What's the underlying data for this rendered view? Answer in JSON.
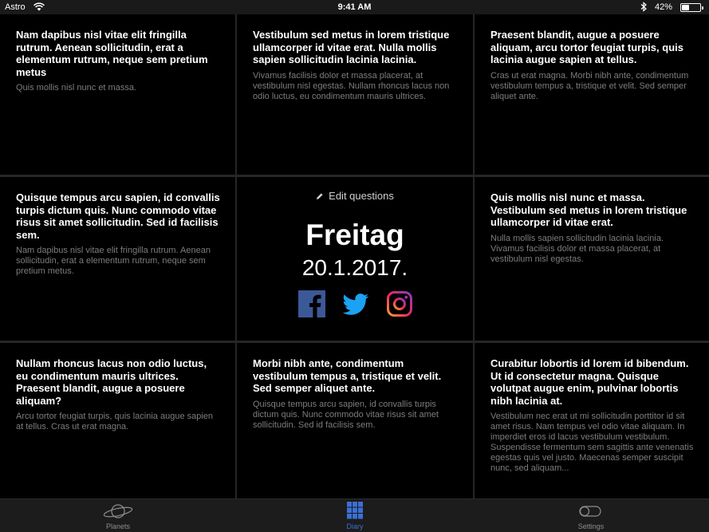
{
  "status_bar": {
    "carrier": "Astro",
    "time": "9:41 AM",
    "battery": "42%",
    "battery_level": 0.42,
    "icons": [
      "wifi-icon",
      "bluetooth-icon",
      "battery-icon"
    ]
  },
  "cards": [
    {
      "question": "Nam dapibus nisl vitae elit fringilla rutrum. Aenean sollicitudin, erat a elementum rutrum, neque sem pretium metus",
      "answer": "Quis mollis nisl nunc et massa."
    },
    {
      "question": "Vestibulum sed metus in lorem tristique ullamcorper id vitae erat. Nulla mollis sapien sollicitudin lacinia lacinia.",
      "answer": "Vivamus facilisis dolor et massa placerat, at vestibulum nisl egestas. Nullam rhoncus lacus non odio luctus, eu condimentum mauris ultrices."
    },
    {
      "question": "Praesent blandit, augue a posuere aliquam, arcu tortor feugiat turpis, quis lacinia augue sapien at tellus.",
      "answer": "Cras ut erat magna. Morbi nibh ante, condimentum vestibulum tempus a, tristique et velit. Sed semper aliquet ante."
    },
    {
      "question": "Quisque tempus arcu sapien, id convallis turpis dictum quis. Nunc commodo vitae risus sit amet sollicitudin. Sed id facilisis sem.",
      "answer": "Nam dapibus nisl vitae elit fringilla rutrum. Aenean sollicitudin, erat a elementum rutrum, neque sem pretium metus."
    },
    {
      "question": "Quis mollis nisl nunc et massa. Vestibulum sed metus in lorem tristique ullamcorper id vitae erat.",
      "answer": "Nulla mollis sapien sollicitudin lacinia lacinia. Vivamus facilisis dolor et massa placerat, at vestibulum nisl egestas."
    },
    {
      "question": "Nullam rhoncus lacus non odio luctus, eu condimentum mauris ultrices. Praesent blandit, augue a posuere aliquam?",
      "answer": "Arcu tortor feugiat turpis, quis lacinia augue sapien at tellus. Cras ut erat magna."
    },
    {
      "question": "Morbi nibh ante, condimentum vestibulum tempus a, tristique et velit. Sed semper aliquet ante.",
      "answer": "Quisque tempus arcu sapien, id convallis turpis dictum quis. Nunc commodo vitae risus sit amet sollicitudin. Sed id facilisis sem."
    },
    {
      "question": "Curabitur lobortis id lorem id bibendum. Ut id consectetur magna. Quisque volutpat augue enim, pulvinar lobortis nibh lacinia at.",
      "answer": "Vestibulum nec erat ut mi sollicitudin porttitor id sit amet risus. Nam tempus vel odio vitae aliquam. In imperdiet eros id lacus vestibulum vestibulum. Suspendisse fermentum sem sagittis ante venenatis egestas quis vel justo. Maecenas semper suscipit nunc, sed aliquam..."
    }
  ],
  "center": {
    "edit_label": "Edit questions",
    "day": "Freitag",
    "date": "20.1.2017.",
    "social": [
      "facebook-icon",
      "twitter-icon",
      "instagram-icon"
    ]
  },
  "tab_bar": {
    "tabs": [
      {
        "label": "Planets",
        "icon": "planet-icon",
        "active": false
      },
      {
        "label": "Diary",
        "icon": "grid-icon",
        "active": true
      },
      {
        "label": "Settings",
        "icon": "toggle-icon",
        "active": false
      }
    ]
  },
  "colors": {
    "background": "#000000",
    "answer_text": "#7d7d7d",
    "active_tab": "#3b6fd6",
    "facebook": "#3b5998",
    "twitter": "#1da1f2"
  }
}
